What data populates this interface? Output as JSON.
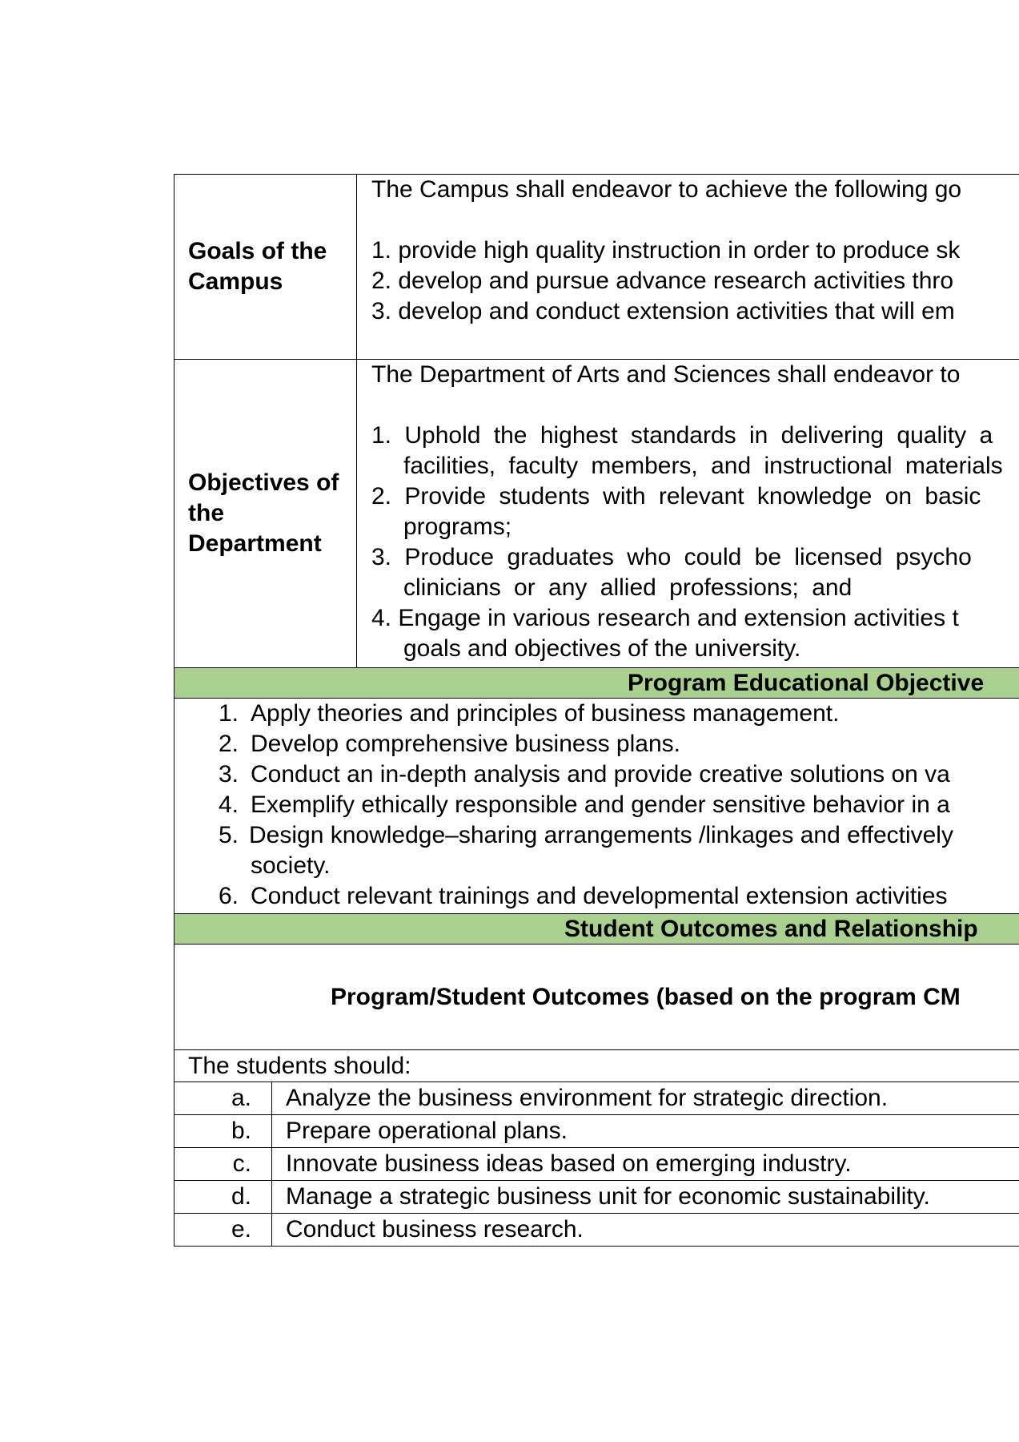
{
  "goals": {
    "label": "Goals of the Campus",
    "intro": "The Campus shall endeavor to achieve the following go",
    "items": [
      "1. provide high quality instruction in order to produce sk",
      "2. develop and pursue advance research activities thro",
      "3. develop and conduct extension activities that will em"
    ]
  },
  "objectives": {
    "label": "Objectives of the Department",
    "intro": "The Department of Arts and Sciences shall endeavor to",
    "items": [
      {
        "num": "1.",
        "line1": "Uphold the highest standards in delivering quality a",
        "line2": "facilities, faculty members, and instructional materials"
      },
      {
        "num": "2.",
        "line1": "Provide students with relevant knowledge on basic",
        "line2": "programs;"
      },
      {
        "num": "3.",
        "line1": "Produce graduates who could be licensed psycho",
        "line2": "clinicians or any allied professions; and"
      },
      {
        "num": "4.",
        "line1": "Engage in various research and extension activities t",
        "line2": "goals and objectives of the university."
      }
    ]
  },
  "peo": {
    "header": "Program Educational Objective",
    "items": [
      {
        "num": "1.",
        "text": "Apply theories and principles of business management."
      },
      {
        "num": "2.",
        "text": "Develop comprehensive business plans."
      },
      {
        "num": "3.",
        "text": "Conduct an in-depth analysis and provide creative solutions on va"
      },
      {
        "num": "4.",
        "text": "Exemplify ethically responsible and gender sensitive behavior in a"
      },
      {
        "num": "5.",
        "text": "Design knowledge–sharing arrangements /linkages and effectively",
        "cont": "society."
      },
      {
        "num": "6.",
        "text": "Conduct relevant trainings and developmental extension activities"
      }
    ]
  },
  "outcomes": {
    "header": "Student Outcomes and Relationship",
    "subheader": "Program/Student Outcomes (based on the program CM",
    "intro": "The students should:",
    "items": [
      {
        "letter": "a.",
        "text": "Analyze the business environment for strategic direction."
      },
      {
        "letter": "b.",
        "text": "Prepare operational plans."
      },
      {
        "letter": "c.",
        "text": "Innovate business ideas based on emerging industry."
      },
      {
        "letter": "d.",
        "text": "Manage a strategic business unit for economic sustainability."
      },
      {
        "letter": "e.",
        "text": "Conduct business research."
      }
    ]
  },
  "colors": {
    "band": "#a9d08e"
  }
}
